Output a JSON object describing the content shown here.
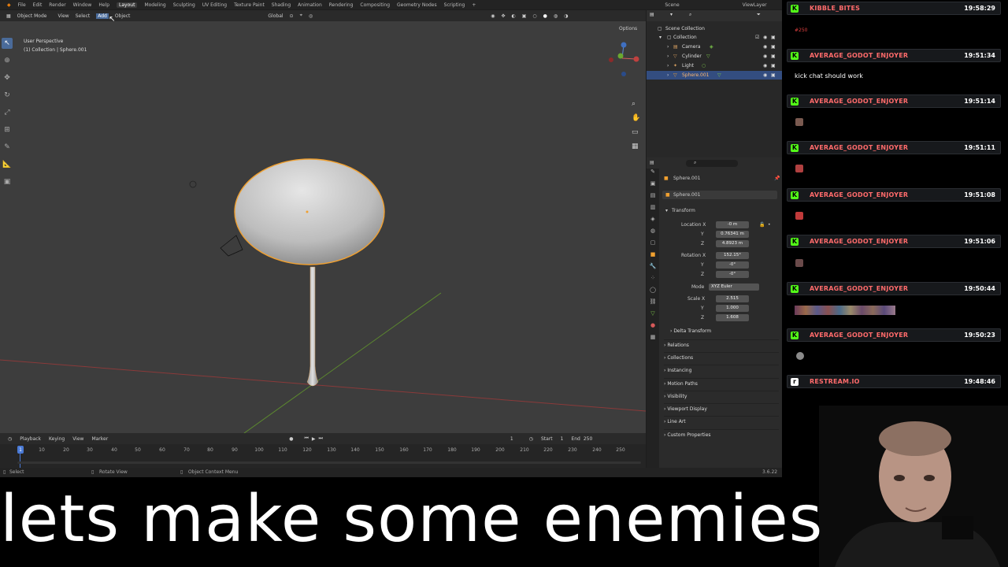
{
  "topbar": {
    "menus": [
      "File",
      "Edit",
      "Render",
      "Window",
      "Help"
    ],
    "workspaces": [
      "Layout",
      "Modeling",
      "Sculpting",
      "UV Editing",
      "Texture Paint",
      "Shading",
      "Animation",
      "Rendering",
      "Compositing",
      "Geometry Nodes",
      "Scripting"
    ],
    "scene": "Scene",
    "view_layer": "ViewLayer"
  },
  "viewport_header": {
    "mode": "Object Mode",
    "menus": [
      "View",
      "Select",
      "Add",
      "Object"
    ],
    "transform": "Global",
    "options": "Options"
  },
  "viewport": {
    "perspective": "User Perspective",
    "collection": "(1) Collection | Sphere.001"
  },
  "timeline": {
    "menus": [
      "Playback",
      "Keying",
      "View",
      "Marker"
    ],
    "current_frame": "1",
    "start_label": "Start",
    "start": "1",
    "end_label": "End",
    "end": "250",
    "ticks": [
      "1",
      "10",
      "20",
      "30",
      "40",
      "50",
      "60",
      "70",
      "80",
      "90",
      "100",
      "110",
      "120",
      "130",
      "140",
      "150",
      "160",
      "170",
      "180",
      "190",
      "200",
      "210",
      "220",
      "230",
      "240",
      "250"
    ]
  },
  "statusbar": {
    "select": "Select",
    "rotate": "Rotate View",
    "context": "Object Context Menu",
    "version": "3.6.22"
  },
  "outliner": {
    "root": "Scene Collection",
    "collection": "Collection",
    "items": [
      "Camera",
      "Cylinder",
      "Light",
      "Sphere.001"
    ]
  },
  "properties": {
    "object_name": "Sphere.001",
    "object_data": "Sphere.001",
    "transform": "Transform",
    "location_label": "Location X",
    "location": [
      "-0 m",
      "0.76341 m",
      "4.8923 m"
    ],
    "rotation_label": "Rotation X",
    "rotation": [
      "152.15°",
      "-0°",
      "-0°"
    ],
    "mode_label": "Mode",
    "mode": "XYZ Euler",
    "scale_label": "Scale X",
    "scale": [
      "2.515",
      "1.000",
      "1.608"
    ],
    "y": "Y",
    "z": "Z",
    "sections": [
      "Delta Transform",
      "Relations",
      "Collections",
      "Instancing",
      "Motion Paths",
      "Visibility",
      "Viewport Display",
      "Line Art",
      "Custom Properties"
    ]
  },
  "chat": [
    {
      "user": "KIBBLE_BITES",
      "time": "19:58:29",
      "text": "#250"
    },
    {
      "user": "AVERAGE_GODOT_ENJOYER",
      "time": "19:51:34",
      "text": "kick chat should work"
    },
    {
      "user": "AVERAGE_GODOT_ENJOYER",
      "time": "19:51:14",
      "text": ""
    },
    {
      "user": "AVERAGE_GODOT_ENJOYER",
      "time": "19:51:11",
      "text": ""
    },
    {
      "user": "AVERAGE_GODOT_ENJOYER",
      "time": "19:51:08",
      "text": ""
    },
    {
      "user": "AVERAGE_GODOT_ENJOYER",
      "time": "19:51:06",
      "text": ""
    },
    {
      "user": "AVERAGE_GODOT_ENJOYER",
      "time": "19:50:44",
      "text": ""
    },
    {
      "user": "AVERAGE_GODOT_ENJOYER",
      "time": "19:50:23",
      "text": ""
    },
    {
      "user": "RESTREAM.IO",
      "time": "19:48:46",
      "text": ""
    }
  ],
  "caption": "lets make some enemies",
  "colors": {
    "accent": "#f0a030",
    "selection": "#334d80",
    "kick": "#53fc18",
    "username": "#ff6b6b"
  }
}
